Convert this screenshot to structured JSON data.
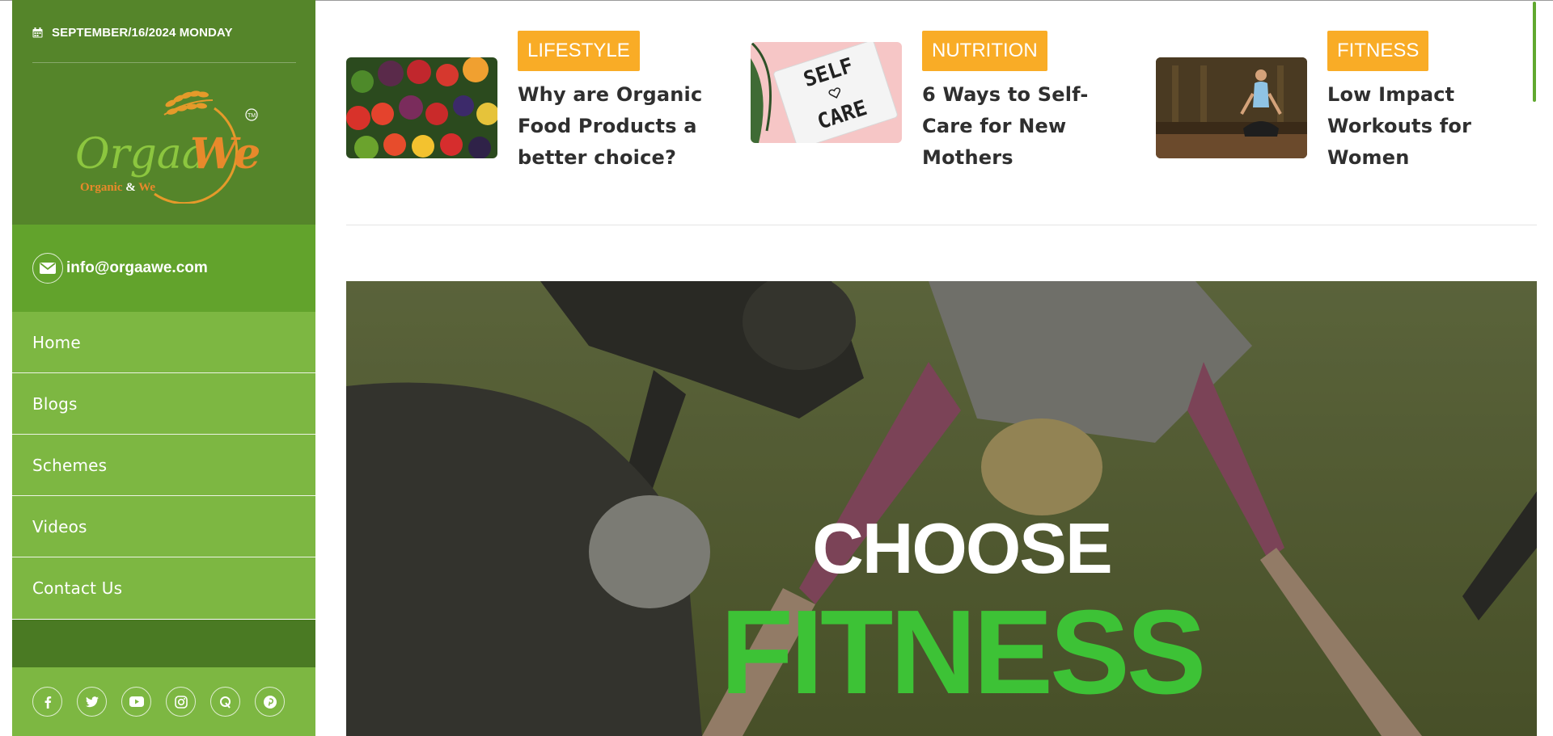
{
  "sidebar": {
    "date": "SEPTEMBER/16/2024 MONDAY",
    "logo": {
      "name": "OrgaaWe",
      "tagline": "Organic & We",
      "mark": "TM"
    },
    "email": "info@orgaawe.com",
    "menu": [
      {
        "label": "Home"
      },
      {
        "label": "Blogs"
      },
      {
        "label": "Schemes"
      },
      {
        "label": "Videos"
      },
      {
        "label": "Contact Us"
      }
    ],
    "social": [
      "facebook-icon",
      "twitter-icon",
      "youtube-icon",
      "instagram-icon",
      "quora-icon",
      "pinterest-icon"
    ]
  },
  "articles": [
    {
      "category": "LIFESTYLE",
      "title": "Why are Organic Food Products a better choice?",
      "image": "vegetables"
    },
    {
      "category": "NUTRITION",
      "title": "6 Ways to Self-Care for New Mothers",
      "image": "self-care-lightbox"
    },
    {
      "category": "FITNESS",
      "title": "Low Impact Workouts for Women",
      "image": "woman-meditating"
    }
  ],
  "hero": {
    "line1": "CHOOSE",
    "line2": "FITNESS"
  },
  "colors": {
    "sidebar_dark": "#55852a",
    "sidebar_email": "#62a32c",
    "menu_green": "#7db742",
    "category_orange": "#f9ac26",
    "hero_green": "#3dc236"
  }
}
